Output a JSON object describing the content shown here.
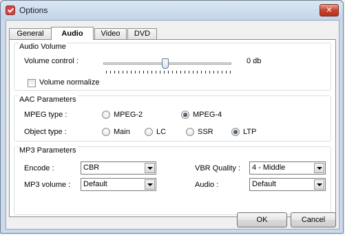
{
  "window": {
    "title": "Options",
    "close_glyph": "✕"
  },
  "tabs": [
    {
      "label": "General"
    },
    {
      "label": "Audio"
    },
    {
      "label": "Video"
    },
    {
      "label": "DVD"
    }
  ],
  "audio_volume": {
    "title": "Audio Volume",
    "volume_label": "Volume control :",
    "volume_value_text": "0 db",
    "slider_position": 0.5,
    "normalize_label": "Volume normalize",
    "normalize_checked": false
  },
  "aac": {
    "title": "AAC Parameters",
    "mpeg_type_label": "MPEG type :",
    "mpeg_options": [
      {
        "label": "MPEG-2",
        "checked": false
      },
      {
        "label": "MPEG-4",
        "checked": true
      }
    ],
    "object_type_label": "Object type :",
    "object_options": [
      {
        "label": "Main",
        "checked": false
      },
      {
        "label": "LC",
        "checked": false
      },
      {
        "label": "SSR",
        "checked": false
      },
      {
        "label": "LTP",
        "checked": true
      }
    ]
  },
  "mp3": {
    "title": "MP3 Parameters",
    "encode_label": "Encode :",
    "encode_value": "CBR",
    "mp3_volume_label": "MP3 volume :",
    "mp3_volume_value": "Default",
    "vbr_quality_label": "VBR Quality :",
    "vbr_quality_value": "4 - Middle",
    "audio_label": "Audio :",
    "audio_value": "Default"
  },
  "buttons": {
    "ok": "OK",
    "cancel": "Cancel"
  },
  "icons": {
    "app": "app-icon",
    "close": "close-icon",
    "dropdown": "chevron-down-icon"
  }
}
